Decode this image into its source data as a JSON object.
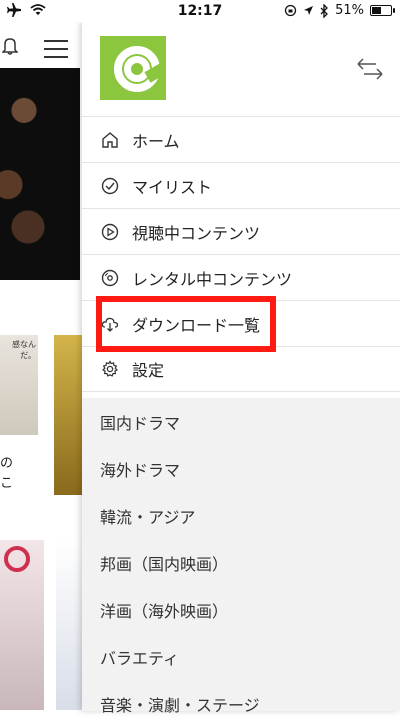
{
  "status_bar": {
    "time": "12:17",
    "battery_percent": "51%",
    "battery_level": 0.51
  },
  "background_app": {
    "snippet_1": "の",
    "snippet_2": "こ",
    "thumb_caption": "感なんだ。"
  },
  "drawer": {
    "logo_icon": "brand-logo",
    "close_icon": "swap-arrows-icon",
    "menu": [
      {
        "label": "ホーム",
        "icon": "home-icon"
      },
      {
        "label": "マイリスト",
        "icon": "check-circle-icon"
      },
      {
        "label": "視聴中コンテンツ",
        "icon": "play-circle-icon"
      },
      {
        "label": "レンタル中コンテンツ",
        "icon": "disc-icon"
      },
      {
        "label": "ダウンロード一覧",
        "icon": "cloud-download-icon"
      },
      {
        "label": "設定",
        "icon": "gear-icon"
      }
    ],
    "genres": [
      {
        "label": "国内ドラマ"
      },
      {
        "label": "海外ドラマ"
      },
      {
        "label": "韓流・アジア"
      },
      {
        "label": "邦画（国内映画）"
      },
      {
        "label": "洋画（海外映画）"
      },
      {
        "label": "バラエティ"
      },
      {
        "label": "音楽・演劇・ステージ"
      }
    ]
  },
  "highlight": {
    "color": "#ff1a12",
    "target": "ダウンロード一覧"
  }
}
